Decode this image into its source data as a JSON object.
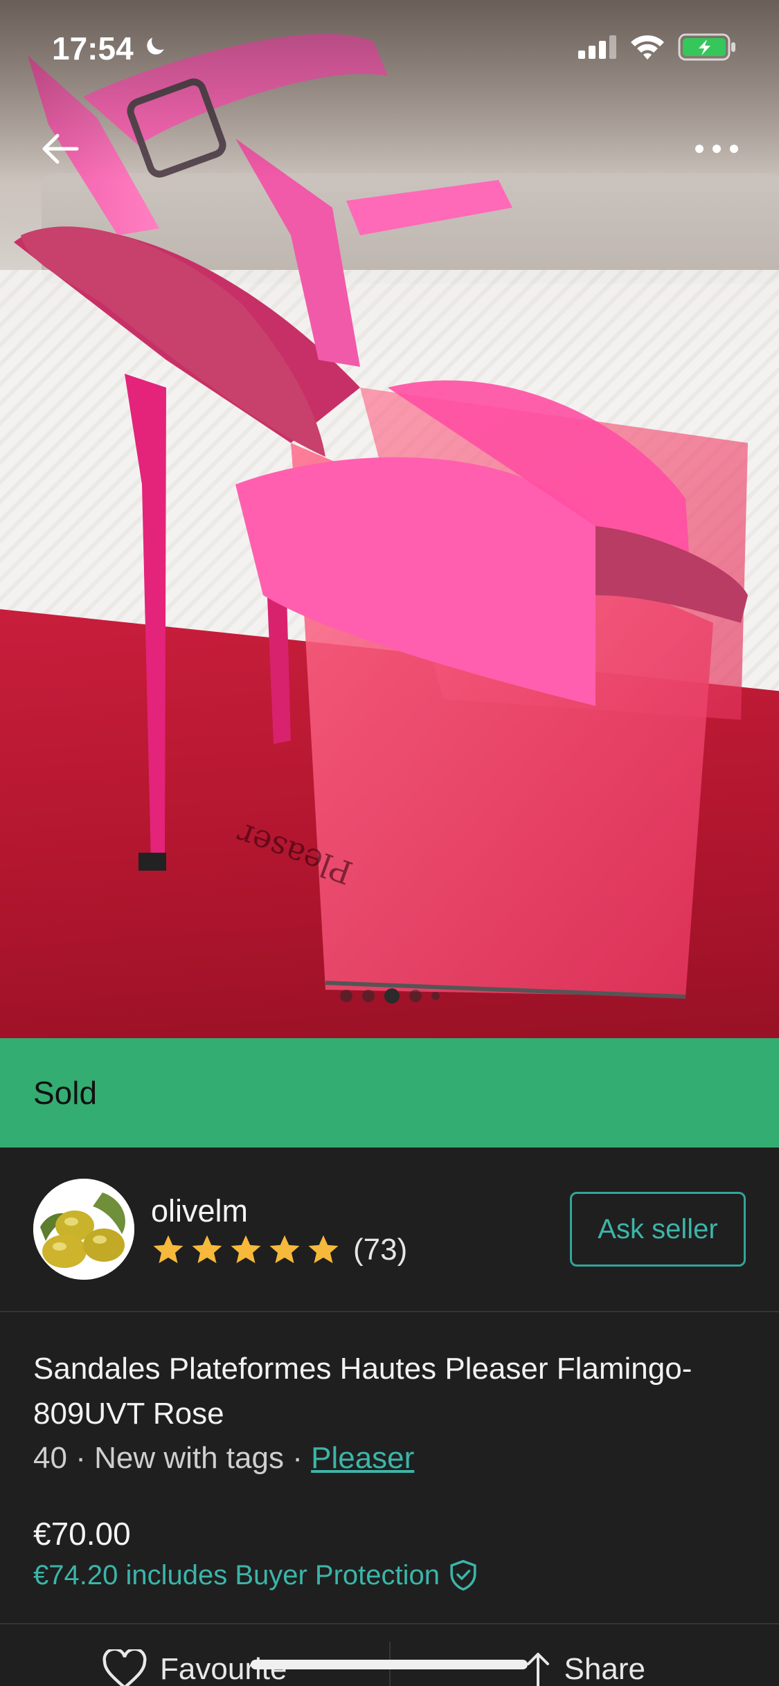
{
  "status_bar": {
    "time": "17:54",
    "icons": [
      "moon-icon",
      "cellular-signal-icon",
      "wifi-icon",
      "battery-charging-icon"
    ]
  },
  "nav": {
    "back_icon": "arrow-left-icon",
    "more_icon": "more-horizontal-icon"
  },
  "gallery": {
    "dots": 5,
    "active_index": 2
  },
  "sold_banner": {
    "label": "Sold",
    "color": "#34ad72"
  },
  "seller": {
    "username": "olivelm",
    "rating_stars": 5,
    "rating_count": "(73)",
    "ask_button": "Ask seller"
  },
  "item": {
    "title": "Sandales Plateformes Hautes Pleaser Flamingo-809UVT Rose",
    "size": "40",
    "condition": "New with tags",
    "brand": "Pleaser",
    "price": "€70.00",
    "buyer_protection": "€74.20 includes Buyer Protection"
  },
  "actions": {
    "favourite": "Favourite",
    "share": "Share"
  },
  "colors": {
    "accent": "#3cb5a9",
    "background": "#1f1f1f",
    "star": "#f6b93b"
  }
}
